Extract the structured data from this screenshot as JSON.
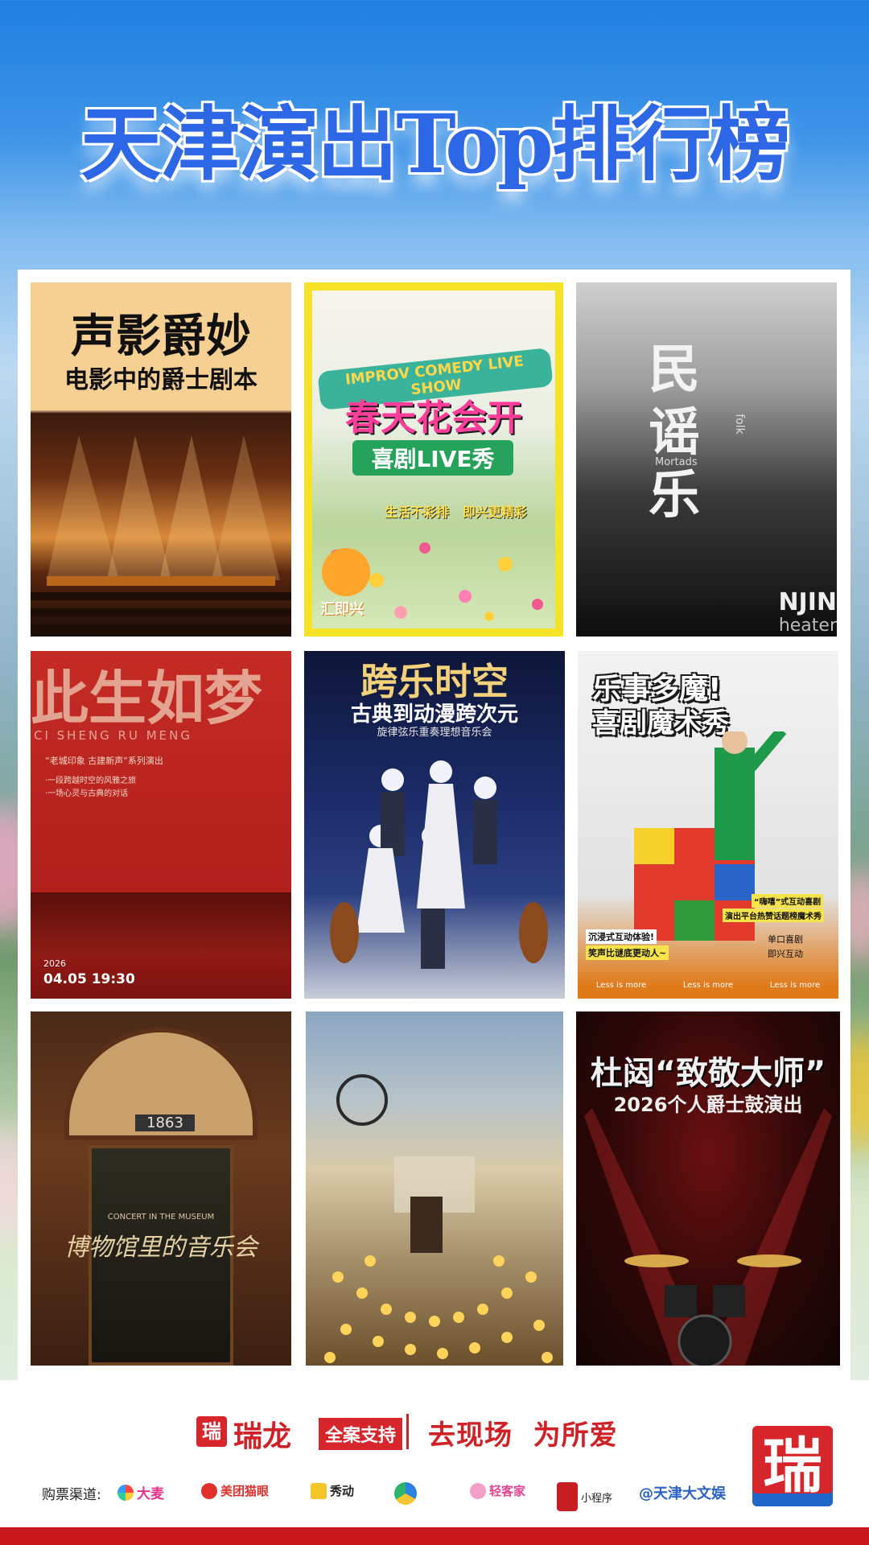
{
  "title": "天津演出Top排行榜",
  "posters": [
    {
      "id": "jazz",
      "title": "声影爵妙",
      "subtitle": "电影中的爵士剧本"
    },
    {
      "id": "comedy",
      "top": "IMPROV COMEDY LIVE SHOW",
      "title": "春天花会开",
      "subtitle": "喜剧LIVE秀",
      "tag1": "生活不彩排",
      "tag2": "即兴更精彩",
      "brand": "汇即兴"
    },
    {
      "id": "folk",
      "title": "民谣乐",
      "side": "folk",
      "side2": "Mortads",
      "bottom": "NJIN",
      "bottom2": "heater"
    },
    {
      "id": "dream",
      "title": "此生如梦",
      "pinyin": "CI SHENG RU MENG",
      "line1": "“老城印象 古建新声”系列演出",
      "line2": "·一段跨越时空的风雅之旅",
      "line3": "·一场心灵与古典的对话",
      "date": "2026",
      "datetime": "04.05 19:30"
    },
    {
      "id": "anime",
      "title": "跨乐时空",
      "subtitle": "古典到动漫跨次元",
      "line": "旋律弦乐重奏理想音乐会"
    },
    {
      "id": "magic",
      "title": "乐事多魔!",
      "subtitle": "喜剧魔术秀",
      "t1": "“嗨嘻”式互动喜剧",
      "t2": "演出平台热赞话题榜魔术秀",
      "t3": "沉浸式互动体验!",
      "t4": "笑声比谜底更动人~",
      "t5": "单口喜剧",
      "t6": "即兴互动",
      "foot": "Less is more"
    },
    {
      "id": "museum",
      "year": "1863",
      "title": "博物馆里的音乐会",
      "en": "CONCERT IN THE MUSEUM"
    },
    {
      "id": "candle"
    },
    {
      "id": "drums",
      "title": "杜闼“致敬大师”",
      "subtitle": "2026个人爵士鼓演出"
    }
  ],
  "footer": {
    "brand_mark": "瑞",
    "brand_name": "瑞龙",
    "support": "全案支持",
    "slogan": "去现场  为所爱",
    "channels_label": "购票渠道:",
    "channels": [
      "大麦",
      "美团猫眼",
      "秀动",
      "",
      "轻客家",
      "小程序",
      "@天津大文娱"
    ],
    "big_logo": "瑞"
  }
}
